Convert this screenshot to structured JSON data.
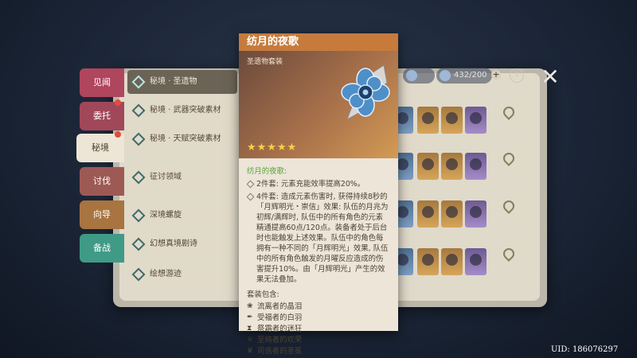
{
  "window": {
    "uid": "UID: 186076297"
  },
  "topbar": {
    "resin1": "",
    "resin2": "432/200",
    "plus": "+",
    "help": "?",
    "close": "✕"
  },
  "tabs": [
    {
      "label": "见闻",
      "badge": false,
      "active": false
    },
    {
      "label": "委托",
      "badge": true,
      "active": false
    },
    {
      "label": "秘境",
      "badge": true,
      "active": true
    },
    {
      "label": "讨伐",
      "badge": false,
      "active": false
    },
    {
      "label": "向导",
      "badge": false,
      "active": false
    },
    {
      "label": "备战",
      "badge": false,
      "active": false
    }
  ],
  "categories": [
    {
      "label": "秘境 · 圣遗物",
      "active": true
    },
    {
      "label": "秘境 · 武器突破素材",
      "active": false
    },
    {
      "label": "秘境 · 天赋突破素材",
      "active": false
    },
    {
      "label": "征讨领域",
      "active": false
    },
    {
      "label": "深境螺旋",
      "active": false
    },
    {
      "label": "幻想真境剧诗",
      "active": false
    },
    {
      "label": "绘想游迹",
      "active": false
    }
  ],
  "tooltip": {
    "title": "纺月的夜歌",
    "type": "圣遗物套装",
    "stars": "★★★★★",
    "set_name": "纺月的夜歌:",
    "effect_2pc": "2件套: 元素充能效率提高20%。",
    "effect_4pc": "4件套: 造成元素伤害时, 获得持续8秒的「月辉明光・崇信」效果: 队伍的月兆为初辉/满辉时, 队伍中的所有角色的元素精通提高60点/120点。装备者处于后台时也能触发上述效果。队伍中的角色每拥有一种不同的「月辉明光」效果, 队伍中的所有角色触发的月曜反应造成的伤害提升10%。由「月辉明光」产生的效果无法叠加。",
    "contains_label": "套装包含:",
    "pieces": [
      {
        "icon": "flower-icon",
        "glyph": "❀",
        "name": "流离者的晶泪"
      },
      {
        "icon": "feather-icon",
        "glyph": "✒",
        "name": "受福者的白羽"
      },
      {
        "icon": "sands-icon",
        "glyph": "⧗",
        "name": "祭霜者的迷狂"
      },
      {
        "icon": "goblet-icon",
        "glyph": "♕",
        "name": "至纯者的欢荣"
      },
      {
        "icon": "circlet-icon",
        "glyph": "♛",
        "name": "司信者的圣冕"
      }
    ]
  },
  "colors": {
    "header": "#c67b3c",
    "set_name": "#5aa438",
    "stars": "#f7cf44"
  }
}
